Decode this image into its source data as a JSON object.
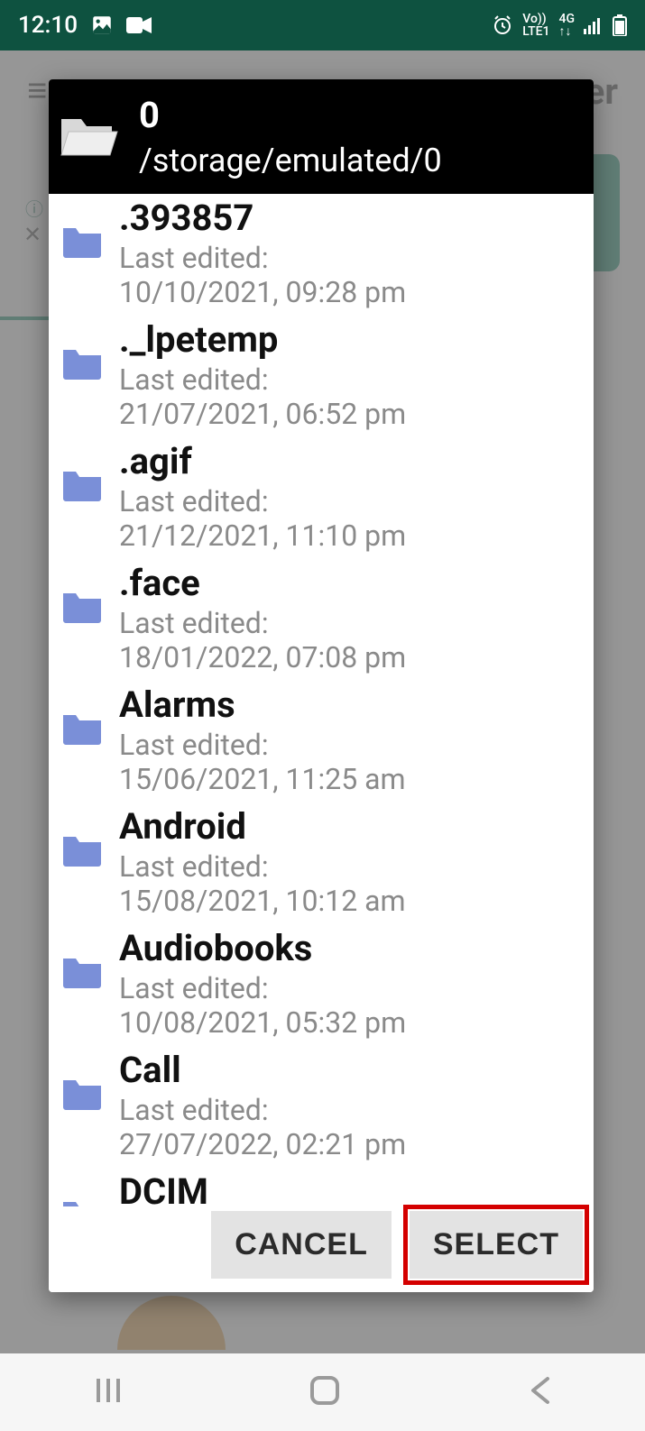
{
  "status": {
    "time": "12:10",
    "network_label": "Vo))",
    "carrier_label": "LTE1",
    "data_label": "4G"
  },
  "background": {
    "title_suffix": "er",
    "menu_icon": "menu-icon"
  },
  "dialog": {
    "current_folder": "0",
    "path": "/storage/emulated/0",
    "last_edited_label": "Last edited:",
    "items": [
      {
        "name": ".393857",
        "date": "10/10/2021, 09:28 pm"
      },
      {
        "name": "._lpetemp",
        "date": "21/07/2021, 06:52 pm"
      },
      {
        "name": ".agif",
        "date": "21/12/2021, 11:10 pm"
      },
      {
        "name": ".face",
        "date": "18/01/2022, 07:08 pm"
      },
      {
        "name": "Alarms",
        "date": "15/06/2021, 11:25 am"
      },
      {
        "name": "Android",
        "date": "15/08/2021, 10:12 am"
      },
      {
        "name": "Audiobooks",
        "date": "10/08/2021, 05:32 pm"
      },
      {
        "name": "Call",
        "date": "27/07/2022, 02:21 pm"
      },
      {
        "name": "DCIM",
        "date": ""
      }
    ],
    "buttons": {
      "cancel": "CANCEL",
      "select": "SELECT"
    }
  }
}
